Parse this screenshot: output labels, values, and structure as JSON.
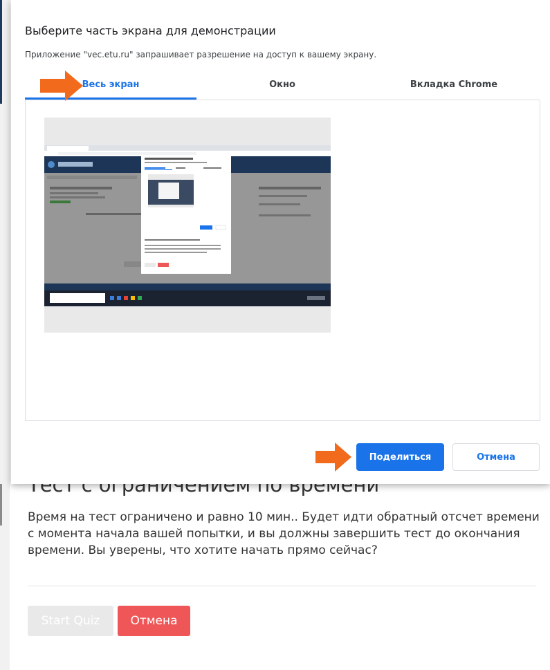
{
  "dialog": {
    "title": "Выберите часть экрана для демонстрации",
    "subtitle": "Приложение \"vec.etu.ru\" запрашивает разрешение на доступ к вашему экрану.",
    "tabs": [
      {
        "label": "Весь экран",
        "active": true
      },
      {
        "label": "Окно",
        "active": false
      },
      {
        "label": "Вкладка Chrome",
        "active": false
      }
    ],
    "share_label": "Поделиться",
    "cancel_label": "Отмена",
    "accent_color": "#1a73e8"
  },
  "quiz": {
    "title": "Тест с ограничением по времени",
    "text": "Время на тест ограничено и равно 10 мин.. Будет идти обратный отсчет времени с момента начала вашей попытки, и вы должны завершить тест до окончания времени. Вы уверены, что хотите начать прямо сейчас?",
    "start_label": "Start Quiz",
    "cancel_label": "Отмена",
    "cancel_color": "#ee5657"
  },
  "annotation": {
    "arrow_color": "#f26a1b"
  }
}
